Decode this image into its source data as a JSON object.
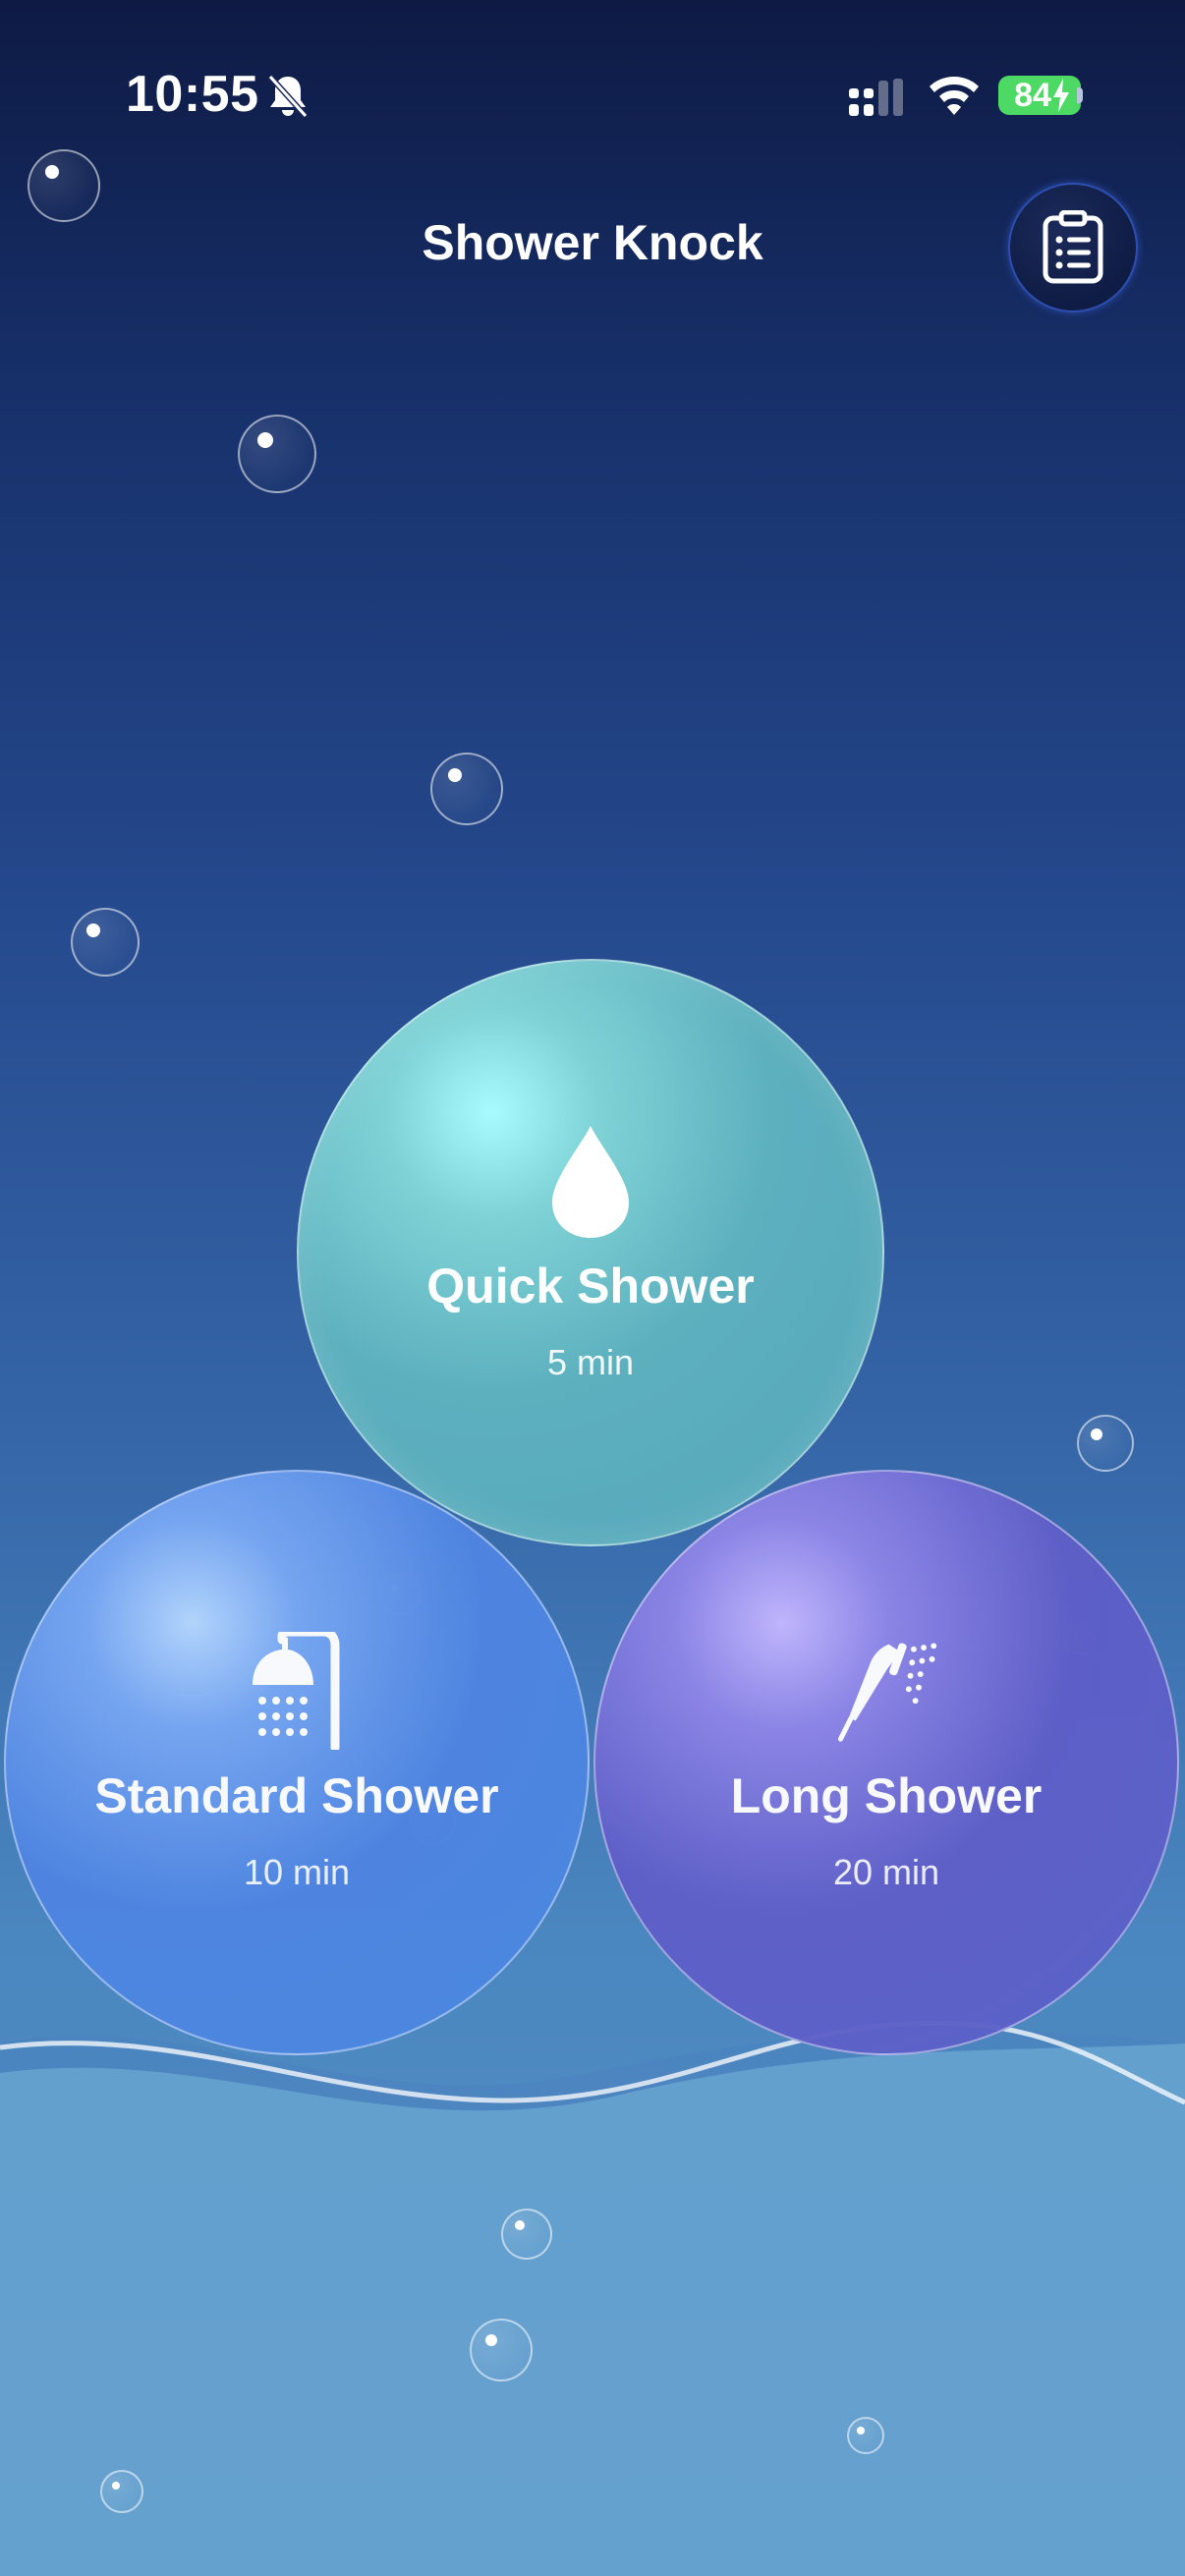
{
  "status_bar": {
    "time": "10:55",
    "battery": "84",
    "icons": [
      "bell-slash-icon",
      "cellular-signal-icon",
      "wifi-icon",
      "battery-charging-icon"
    ]
  },
  "header": {
    "title": "Shower Knock",
    "log_button_icon": "clipboard-list-icon"
  },
  "showers": [
    {
      "name": "Quick Shower",
      "duration": "5 min",
      "icon": "water-drop-icon",
      "color": "#5db0be"
    },
    {
      "name": "Standard Shower",
      "duration": "10 min",
      "icon": "shower-head-icon",
      "color": "#4f85e2"
    },
    {
      "name": "Long Shower",
      "duration": "20 min",
      "icon": "handheld-shower-icon",
      "color": "#5f5ec8"
    }
  ],
  "colors": {
    "background_top": "#0e1a44",
    "background_bottom": "#5a96c8",
    "battery": "#4cd964"
  }
}
